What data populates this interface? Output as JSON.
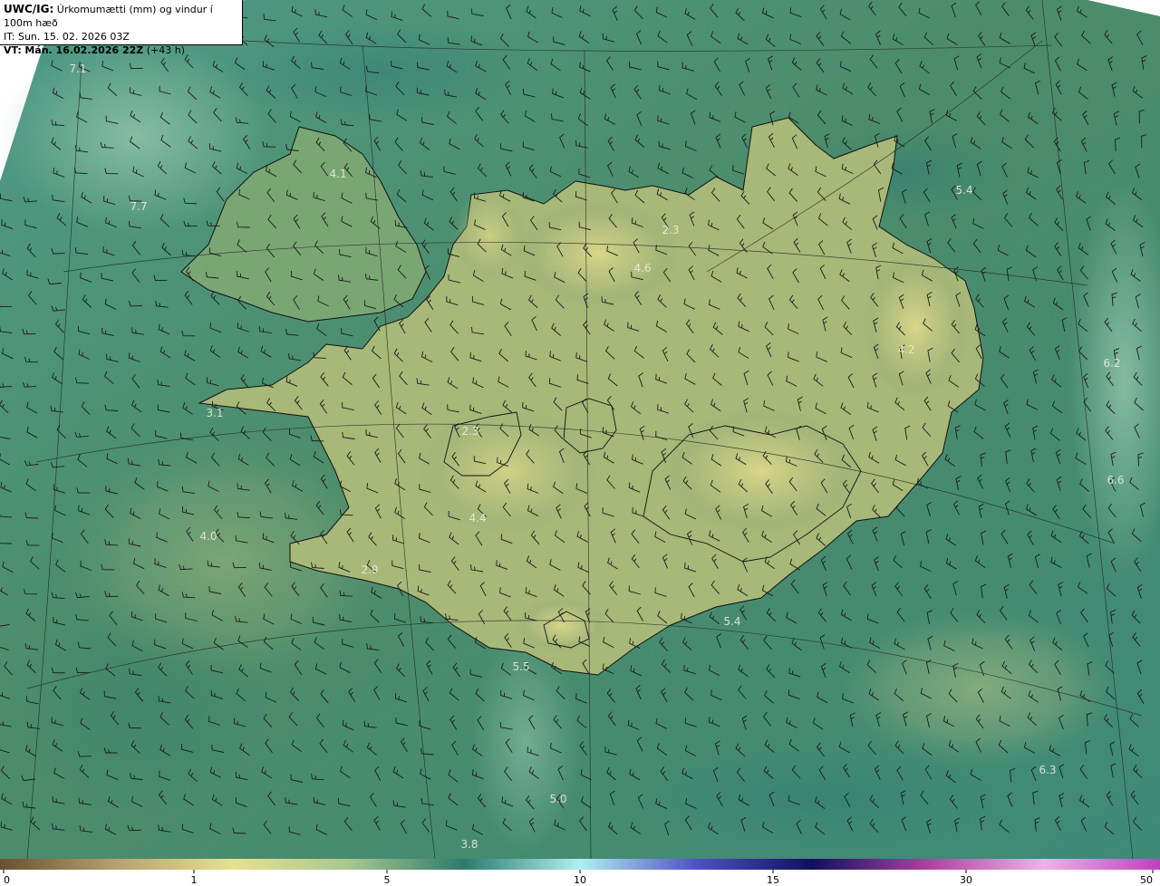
{
  "header": {
    "model": "UWC/IG:",
    "title": "Úrkomumætti (mm) og vindur í 100m hæð",
    "init_time": "IT: Sun. 15. 02. 2026 03Z",
    "valid_prefix": "VT:",
    "valid_time": "Mán. 16.02.2026 22Z",
    "lead": "(+43 h)"
  },
  "colorbar": {
    "ticks": [
      {
        "label": "0",
        "value": 0
      },
      {
        "label": "1",
        "value": 1
      },
      {
        "label": "5",
        "value": 5
      },
      {
        "label": "10",
        "value": 10
      },
      {
        "label": "15",
        "value": 15
      },
      {
        "label": "30",
        "value": 30
      },
      {
        "label": "50",
        "value": 50
      }
    ],
    "colors": [
      "#6b5030",
      "#b8a070",
      "#e8e090",
      "#a8c890",
      "#2e7a6e",
      "#b0f0f0",
      "#5050c8",
      "#101060",
      "#b040a0",
      "#f0b0e8",
      "#c040c0"
    ]
  },
  "map_values": [
    {
      "label": "7.1",
      "value": 7.1
    },
    {
      "label": "4.1",
      "value": 4.1
    },
    {
      "label": "7.7",
      "value": 7.7
    },
    {
      "label": "2.3",
      "value": 2.3
    },
    {
      "label": "5.4",
      "value": 5.4
    },
    {
      "label": "4.6",
      "value": 4.6
    },
    {
      "label": "4.2",
      "value": 4.2
    },
    {
      "label": "6.2",
      "value": 6.2
    },
    {
      "label": "3.1",
      "value": 3.1
    },
    {
      "label": "2.3",
      "value": 2.3
    },
    {
      "label": "6.6",
      "value": 6.6
    },
    {
      "label": "4.4",
      "value": 4.4
    },
    {
      "label": "4.0",
      "value": 4.0
    },
    {
      "label": "2.9",
      "value": 2.9
    },
    {
      "label": "5.4",
      "value": 5.4
    },
    {
      "label": "5.5",
      "value": 5.5
    },
    {
      "label": "6.3",
      "value": 6.3
    },
    {
      "label": "5.0",
      "value": 5.0
    },
    {
      "label": "3.8",
      "value": 3.8
    }
  ]
}
